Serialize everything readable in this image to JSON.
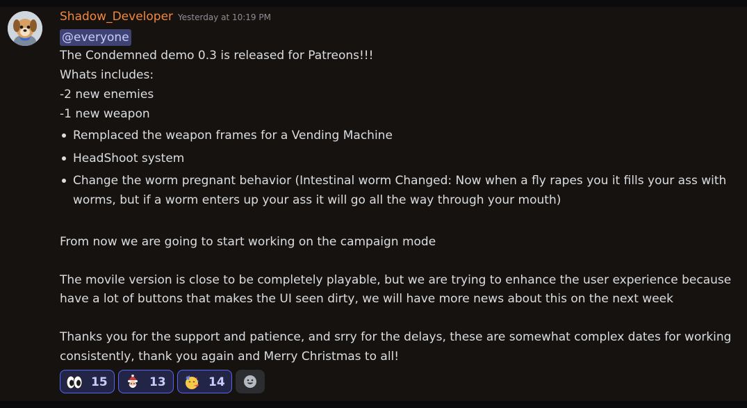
{
  "message": {
    "username": "Shadow_Developer",
    "timestamp": "Yesterday at 10:19 PM",
    "mention": "@everyone",
    "lines": [
      "The Condemned demo 0.3 is released for Patreons!!!",
      "Whats includes:",
      "-2 new enemies",
      "-1 new weapon"
    ],
    "bullets": [
      "Remplaced the weapon frames for a Vending Machine",
      "HeadShoot system",
      "Change the worm pregnant behavior (Intestinal worm Changed: Now when a fly rapes you it fills your ass with",
      "worms, but if a worm enters up your ass it will go all the way through your mouth)"
    ],
    "paragraphs": [
      "From now we are going to start working on the campaign mode",
      "The movile version is close to be completely playable, but we are trying to enhance the user experience because",
      "have a lot of buttons that makes the UI seen dirty, we will have more news about this on the next week",
      "Thanks you for the support and patience, and srry for the delays, these are somewhat complex dates for working",
      "consistently, thank you again and Merry Christmas to all!"
    ]
  },
  "reactions": [
    {
      "emoji": "eyes-emoji",
      "count": "15"
    },
    {
      "emoji": "santa-emoji",
      "count": "13"
    },
    {
      "emoji": "party-face-emoji",
      "count": "14"
    }
  ],
  "add_reaction_icon": "add-reaction-smile-icon",
  "colors": {
    "username": "#f0883e",
    "mention_bg": "#3e4275",
    "reaction_border": "#5865f2",
    "background": "#161210"
  }
}
